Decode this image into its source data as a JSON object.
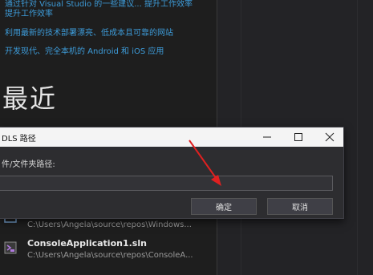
{
  "start_links": [
    "通过针对 Visual Studio 的一些建议... 提升工作效率",
    "提升工作效率",
    "利用最新的技术部署漂亮、低成本且可靠的网站",
    "开发现代、完全本机的 Android 和 iOS 应用"
  ],
  "recent": {
    "heading": "最近"
  },
  "projects": [
    {
      "name": "",
      "path": "C:\\Users\\Angela\\source\\repos\\Windows..."
    },
    {
      "name": "ConsoleApplication1.sln",
      "path": "C:\\Users\\Angela\\source\\repos\\ConsoleA..."
    }
  ],
  "dialog": {
    "title": "DLS 路径",
    "label": "件/文件夹路径:",
    "path_value": "",
    "ok_label": "确定",
    "cancel_label": "取消"
  },
  "colors": {
    "link": "#3d9bd8",
    "arrow": "#e02020"
  },
  "icons": [
    "minimize-icon",
    "maximize-icon",
    "close-icon",
    "solution-icon"
  ]
}
